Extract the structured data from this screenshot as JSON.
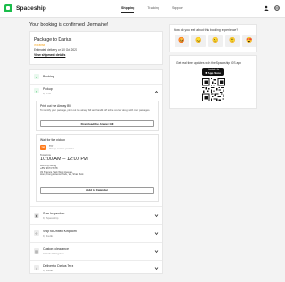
{
  "app": {
    "name": "Spaceship"
  },
  "nav": {
    "items": [
      "Shipping",
      "Tracking",
      "Support"
    ],
    "active": "Shipping"
  },
  "icons": {
    "user": "user-icon",
    "globe": "globe-icon",
    "apple": "apple-icon"
  },
  "colors": {
    "accent": "#1bbd4b",
    "warning": "#f5a31a",
    "carrier": "#ff7a1a"
  },
  "heading": "Your booking is confirmed, Jermaine!",
  "package": {
    "title": "Package to Darius",
    "status": "In transit",
    "eta": "Estimated delivery on 10 Oct 2021",
    "link": "View shipment details"
  },
  "timeline": {
    "booking": {
      "title": "Booking"
    },
    "pickup": {
      "title": "Pickup",
      "by": "by TNT",
      "print": {
        "title": "Print out the Airway Bill",
        "text": "To identify your package, print out the airway bill and hand it off to the courier along with your packages.",
        "button": "Download the Airway Bill"
      },
      "wait": {
        "title": "Wait for the pickup",
        "carrier": "TNT",
        "carrier_badge": "TNT",
        "service": "Pickup service provider",
        "day": "Tomorrow",
        "time": "10:00 AM – 12:00 PM",
        "contact_name": "Anthony Leung",
        "contact_phone": "+852 9673 5678",
        "address_1": "33 Science Park West Avenue,",
        "address_2": "Hong Kong Science Park, Tai, Shaw Kok",
        "button": "Add to Calendar"
      }
    },
    "size": {
      "title": "Size Inspection",
      "by": "by Spaceship"
    },
    "ship": {
      "title": "Ship to United Kingdom",
      "by": "by FedEx"
    },
    "customs": {
      "title": "Custom clearance",
      "by": "in United Kingdom"
    },
    "deliver": {
      "title": "Deliver to Darius Terz",
      "by": "by FedEx"
    }
  },
  "experience": {
    "question": "How do you feel about this booking experience?",
    "emojis": [
      "😡",
      "😞",
      "😐",
      "🙂",
      "😍"
    ]
  },
  "app_promo": {
    "text": "Get real time updates with the Spaceship iOS app",
    "store_line1": "Download on the",
    "store_line2": "App Store"
  }
}
